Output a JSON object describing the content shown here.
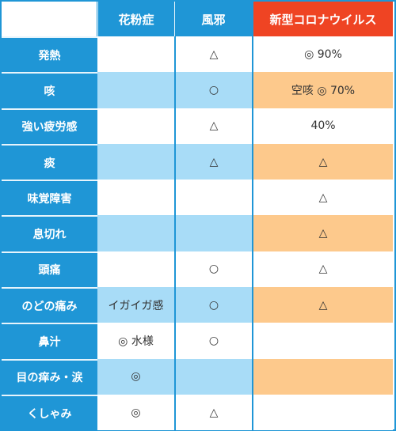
{
  "table": {
    "corner": "",
    "columns": [
      "花粉症",
      "風邪",
      "新型コロナウイルス"
    ],
    "rows": [
      {
        "symptom": "発熱",
        "hay_fever": "",
        "cold": "△",
        "covid": "◎ 90%"
      },
      {
        "symptom": "咳",
        "hay_fever": "",
        "cold": "○",
        "covid": "空咳 ◎ 70%"
      },
      {
        "symptom": "強い疲労感",
        "hay_fever": "",
        "cold": "△",
        "covid": "40%"
      },
      {
        "symptom": "痰",
        "hay_fever": "",
        "cold": "△",
        "covid": "△"
      },
      {
        "symptom": "味覚障害",
        "hay_fever": "",
        "cold": "",
        "covid": "△"
      },
      {
        "symptom": "息切れ",
        "hay_fever": "",
        "cold": "",
        "covid": "△"
      },
      {
        "symptom": "頭痛",
        "hay_fever": "",
        "cold": "○",
        "covid": "△"
      },
      {
        "symptom": "のどの痛み",
        "hay_fever": "イガイガ感",
        "cold": "○",
        "covid": "△"
      },
      {
        "symptom": "鼻汁",
        "hay_fever": "◎ 水様",
        "cold": "○",
        "covid": ""
      },
      {
        "symptom": "目の痒み・涙",
        "hay_fever": "◎",
        "cold": "",
        "covid": ""
      },
      {
        "symptom": "くしゃみ",
        "hay_fever": "◎",
        "cold": "△",
        "covid": ""
      }
    ]
  },
  "colors": {
    "header_blue": "#1f96d6",
    "covid_red": "#ef4423",
    "row_light_blue": "#a8dcf7",
    "row_orange": "#fdc98c"
  }
}
